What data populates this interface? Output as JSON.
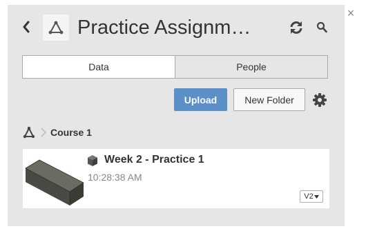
{
  "header": {
    "title": "Practice Assignm…",
    "close_glyph": "×",
    "icons": {
      "back": "chevron-left-icon",
      "project": "fusion-hub-icon",
      "refresh": "refresh-icon",
      "search": "search-icon",
      "close": "close-icon"
    }
  },
  "tabs": [
    {
      "label": "Data",
      "active": true
    },
    {
      "label": "People",
      "active": false
    }
  ],
  "toolbar": {
    "upload_label": "Upload",
    "new_folder_label": "New Folder",
    "settings_icon": "gear-icon"
  },
  "breadcrumb": {
    "home_icon": "hub-home-icon",
    "separator_icon": "chevron-right-icon",
    "current": "Course 1"
  },
  "items": [
    {
      "name": "Week 2 - Practice 1",
      "time": "10:28:38 AM",
      "version": "V2",
      "type_icon": "3d-model-icon",
      "thumbnail": "box-model-thumbnail"
    }
  ],
  "colors": {
    "panel_bg": "#e6e6e6",
    "accent": "#5a8fc7",
    "text": "#333333",
    "muted_text": "#888888"
  }
}
